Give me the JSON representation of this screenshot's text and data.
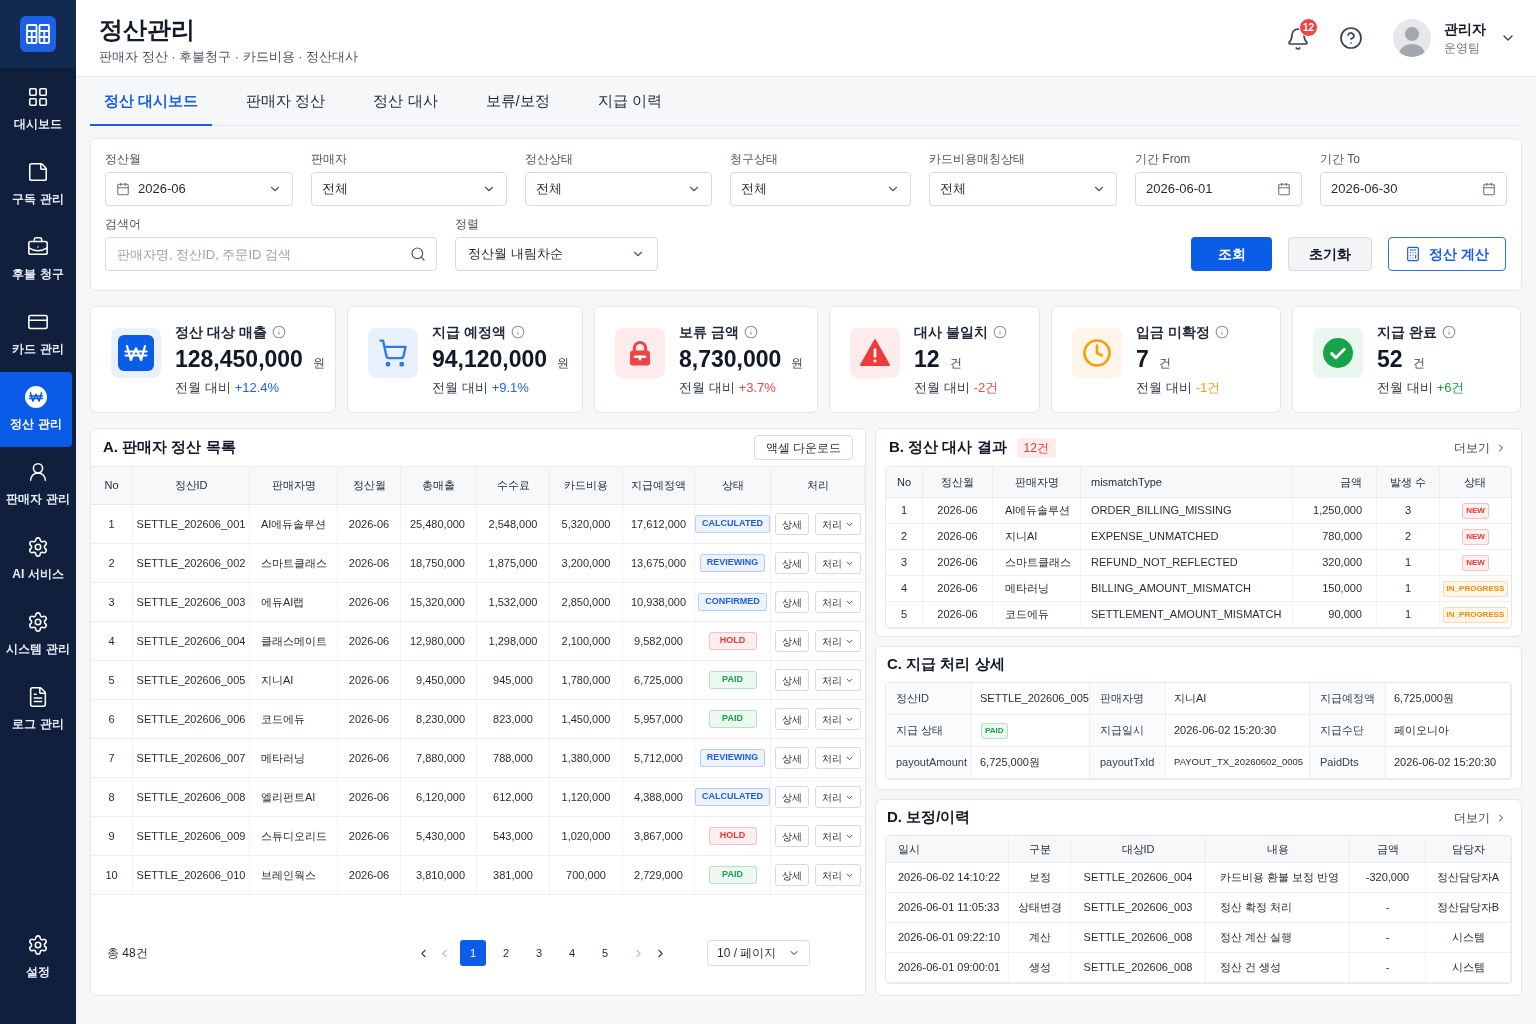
{
  "sidebar": {
    "items": [
      {
        "label": "대시보드",
        "selected": false
      },
      {
        "label": "구독 관리",
        "selected": false
      },
      {
        "label": "후불 청구",
        "selected": false
      },
      {
        "label": "카드 관리",
        "selected": false
      },
      {
        "label": "정산 관리",
        "selected": true
      },
      {
        "label": "판매자 관리",
        "selected": false
      },
      {
        "label": "AI 서비스",
        "selected": false
      },
      {
        "label": "시스템 관리",
        "selected": false
      },
      {
        "label": "로그 관리",
        "selected": false
      }
    ],
    "bottom_items": [
      {
        "label": "설정",
        "selected": false
      }
    ]
  },
  "header": {
    "title": "정산관리",
    "subtitle": "판매자 정산 · 후불청구 · 카드비용 · 정산대사",
    "notification_count": "12",
    "user": {
      "name": "관리자",
      "team": "운영팀"
    }
  },
  "tabs": [
    {
      "label": "정산 대시보드",
      "selected": true
    },
    {
      "label": "판매자 정산",
      "selected": false
    },
    {
      "label": "정산 대사",
      "selected": false
    },
    {
      "label": "보류/보정",
      "selected": false
    },
    {
      "label": "지급 이력",
      "selected": false
    }
  ],
  "filters": {
    "fields": [
      {
        "label": "정산월",
        "value": "2026-06",
        "kind": "month"
      },
      {
        "label": "판매자",
        "value": "전체",
        "kind": "select"
      },
      {
        "label": "정산상태",
        "value": "전체",
        "kind": "select"
      },
      {
        "label": "청구상태",
        "value": "전체",
        "kind": "select"
      },
      {
        "label": "카드비용매칭상태",
        "value": "전체",
        "kind": "select"
      },
      {
        "label": "기간 From",
        "value": "2026-06-01",
        "kind": "date"
      },
      {
        "label": "기간 To",
        "value": "2026-06-30",
        "kind": "date"
      }
    ],
    "search": {
      "label": "검색어",
      "placeholder": "판매자명, 정산ID, 주문ID 검색"
    },
    "sort": {
      "label": "정렬",
      "value": "정산월 내림차순"
    },
    "buttons": [
      {
        "label": "조회",
        "kind": "primary"
      },
      {
        "label": "초기화",
        "kind": "secondary"
      },
      {
        "label": "정산 계산",
        "kind": "outline"
      }
    ]
  },
  "kpis": [
    {
      "title": "정산 대상 매출",
      "value": "128,450,000",
      "unit": "원",
      "change_label": "전월 대비",
      "change": "+12.4%",
      "color": "#1f63e6"
    },
    {
      "title": "지급 예정액",
      "value": "94,120,000",
      "unit": "원",
      "change_label": "전월 대비",
      "change": "+9.1%",
      "color": "#1f63e6"
    },
    {
      "title": "보류 금액",
      "value": "8,730,000",
      "unit": "원",
      "change_label": "전월 대비",
      "change": "+3.7%",
      "color": "#ef4444"
    },
    {
      "title": "대사 불일치",
      "value": "12",
      "unit": "건",
      "change_label": "전월 대비",
      "change": "-2건",
      "color": "#ef4444"
    },
    {
      "title": "입금 미확정",
      "value": "7",
      "unit": "건",
      "change_label": "전월 대비",
      "change": "-1건",
      "color": "#f59e0b"
    },
    {
      "title": "지급 완료",
      "value": "52",
      "unit": "건",
      "change_label": "전월 대비",
      "change": "+6건",
      "color": "#16a34a"
    }
  ],
  "settlement_list": {
    "title": "A. 판매자 정산 목록",
    "download_button": "액셀 다운로드",
    "columns": [
      "No",
      "정산ID",
      "판매자명",
      "정산월",
      "총매출",
      "수수료",
      "카드비용",
      "지급예정액",
      "상태",
      "처리"
    ],
    "rows": [
      {
        "cells": [
          "1",
          "SETTLE_202606_001",
          "AI에듀솔루션",
          "2026-06",
          "25,480,000",
          "2,548,000",
          "5,320,000",
          "17,612,000"
        ],
        "status": {
          "label": "CALCULATED",
          "color": "#1d5fe0"
        },
        "actions": [
          {
            "label": "상세",
            "kind": "button"
          },
          {
            "label": "처리",
            "kind": "menu"
          }
        ]
      },
      {
        "cells": [
          "2",
          "SETTLE_202606_002",
          "스마트클래스",
          "2026-06",
          "18,750,000",
          "1,875,000",
          "3,200,000",
          "13,675,000"
        ],
        "status": {
          "label": "REVIEWING",
          "color": "#1d5fe0"
        },
        "actions": [
          {
            "label": "상세",
            "kind": "button"
          },
          {
            "label": "처리",
            "kind": "menu"
          }
        ]
      },
      {
        "cells": [
          "3",
          "SETTLE_202606_003",
          "에듀AI랩",
          "2026-06",
          "15,320,000",
          "1,532,000",
          "2,850,000",
          "10,938,000"
        ],
        "status": {
          "label": "CONFIRMED",
          "color": "#1d5fe0"
        },
        "actions": [
          {
            "label": "상세",
            "kind": "button"
          },
          {
            "label": "처리",
            "kind": "menu"
          }
        ]
      },
      {
        "cells": [
          "4",
          "SETTLE_202606_004",
          "클래스메이트",
          "2026-06",
          "12,980,000",
          "1,298,000",
          "2,100,000",
          "9,582,000"
        ],
        "status": {
          "label": "HOLD",
          "color": "#e53935"
        },
        "actions": [
          {
            "label": "상세",
            "kind": "button"
          },
          {
            "label": "처리",
            "kind": "menu"
          }
        ]
      },
      {
        "cells": [
          "5",
          "SETTLE_202606_005",
          "지니AI",
          "2026-06",
          "9,450,000",
          "945,000",
          "1,780,000",
          "6,725,000"
        ],
        "status": {
          "label": "PAID",
          "color": "#16a34a"
        },
        "actions": [
          {
            "label": "상세",
            "kind": "button"
          },
          {
            "label": "처리",
            "kind": "menu"
          }
        ]
      },
      {
        "cells": [
          "6",
          "SETTLE_202606_006",
          "코드에듀",
          "2026-06",
          "8,230,000",
          "823,000",
          "1,450,000",
          "5,957,000"
        ],
        "status": {
          "label": "PAID",
          "color": "#16a34a"
        },
        "actions": [
          {
            "label": "상세",
            "kind": "button"
          },
          {
            "label": "처리",
            "kind": "menu"
          }
        ]
      },
      {
        "cells": [
          "7",
          "SETTLE_202606_007",
          "메타러닝",
          "2026-06",
          "7,880,000",
          "788,000",
          "1,380,000",
          "5,712,000"
        ],
        "status": {
          "label": "REVIEWING",
          "color": "#1d5fe0"
        },
        "actions": [
          {
            "label": "상세",
            "kind": "button"
          },
          {
            "label": "처리",
            "kind": "menu"
          }
        ]
      },
      {
        "cells": [
          "8",
          "SETTLE_202606_008",
          "엘리펀트AI",
          "2026-06",
          "6,120,000",
          "612,000",
          "1,120,000",
          "4,388,000"
        ],
        "status": {
          "label": "CALCULATED",
          "color": "#1d5fe0"
        },
        "actions": [
          {
            "label": "상세",
            "kind": "button"
          },
          {
            "label": "처리",
            "kind": "menu"
          }
        ]
      },
      {
        "cells": [
          "9",
          "SETTLE_202606_009",
          "스튜디오리드",
          "2026-06",
          "5,430,000",
          "543,000",
          "1,020,000",
          "3,867,000"
        ],
        "status": {
          "label": "HOLD",
          "color": "#e53935"
        },
        "actions": [
          {
            "label": "상세",
            "kind": "button"
          },
          {
            "label": "처리",
            "kind": "menu"
          }
        ]
      },
      {
        "cells": [
          "10",
          "SETTLE_202606_010",
          "브레인웍스",
          "2026-06",
          "3,810,000",
          "381,000",
          "700,000",
          "2,729,000"
        ],
        "status": {
          "label": "PAID",
          "color": "#16a34a"
        },
        "actions": [
          {
            "label": "상세",
            "kind": "button"
          },
          {
            "label": "처리",
            "kind": "menu"
          }
        ]
      }
    ],
    "pagination": {
      "total": "총 48건",
      "nav_start": [
        {
          "disabled": false
        },
        {
          "disabled": true
        }
      ],
      "pages": [
        {
          "label": "1",
          "selected": true
        },
        {
          "label": "2",
          "selected": false
        },
        {
          "label": "3",
          "selected": false
        },
        {
          "label": "4",
          "selected": false
        },
        {
          "label": "5",
          "selected": false
        }
      ],
      "nav_end": [
        {
          "disabled": true
        },
        {
          "disabled": false
        }
      ],
      "page_size": "10 / 페이지"
    }
  },
  "reconciliation": {
    "title": "B. 정산 대사 결과",
    "count": "12건",
    "more_link": "더보기",
    "columns": [
      "No",
      "정산월",
      "판매자명",
      "mismatchType",
      "금액",
      "발생 수",
      "상태"
    ],
    "rows": [
      {
        "cells": [
          "1",
          "2026-06",
          "AI에듀솔루션",
          "ORDER_BILLING_MISSING",
          "1,250,000",
          "3"
        ],
        "status": {
          "label": "NEW",
          "color": "#e53935"
        }
      },
      {
        "cells": [
          "2",
          "2026-06",
          "지니AI",
          "EXPENSE_UNMATCHED",
          "780,000",
          "2"
        ],
        "status": {
          "label": "NEW",
          "color": "#e53935"
        }
      },
      {
        "cells": [
          "3",
          "2026-06",
          "스마트클래스",
          "REFUND_NOT_REFLECTED",
          "320,000",
          "1"
        ],
        "status": {
          "label": "NEW",
          "color": "#e53935"
        }
      },
      {
        "cells": [
          "4",
          "2026-06",
          "메타러닝",
          "BILLING_AMOUNT_MISMATCH",
          "150,000",
          "1"
        ],
        "status": {
          "label": "IN_PROGRESS",
          "color": "#f08c00"
        }
      },
      {
        "cells": [
          "5",
          "2026-06",
          "코드에듀",
          "SETTLEMENT_AMOUNT_MISMATCH",
          "90,000",
          "1"
        ],
        "status": {
          "label": "IN_PROGRESS",
          "color": "#f08c00"
        }
      }
    ]
  },
  "payout_detail": {
    "title": "C. 지급 처리 상세",
    "rows": [
      {
        "cells": [
          {
            "label": "정산ID",
            "value": "SETTLE_202606_005",
            "kind": "text"
          },
          {
            "label": "판매자명",
            "value": "지니AI",
            "kind": "text"
          },
          {
            "label": "지급예정액",
            "value": "6,725,000원",
            "kind": "text"
          }
        ]
      },
      {
        "cells": [
          {
            "label": "지급 상태",
            "value": "PAID",
            "kind": "badge",
            "color": "#16a34a"
          },
          {
            "label": "지급일시",
            "value": "2026-06-02 15:20:30",
            "kind": "text"
          },
          {
            "label": "지급수단",
            "value": "페이오니아",
            "kind": "text"
          }
        ]
      },
      {
        "cells": [
          {
            "label": "payoutAmount",
            "value": "6,725,000원",
            "kind": "text"
          },
          {
            "label": "payoutTxId",
            "value": "PAYOUT_TX_20260602_0005",
            "kind": "small"
          },
          {
            "label": "PaidDts",
            "value": "2026-06-02 15:20:30",
            "kind": "text"
          }
        ]
      }
    ]
  },
  "history": {
    "title": "D. 보정/이력",
    "more_link": "더보기",
    "columns": [
      "일시",
      "구분",
      "대상ID",
      "내용",
      "금액",
      "담당자"
    ],
    "rows": [
      {
        "cells": [
          "2026-06-02 14:10:22",
          "보정",
          "SETTLE_202606_004",
          "카드비용 환불 보정 반영",
          "-320,000",
          "정산담당자A"
        ]
      },
      {
        "cells": [
          "2026-06-01 11:05:33",
          "상태변경",
          "SETTLE_202606_003",
          "정산 확정 처리",
          "-",
          "정산담당자B"
        ]
      },
      {
        "cells": [
          "2026-06-01 09:22:10",
          "계산",
          "SETTLE_202606_008",
          "정산 계산 실행",
          "-",
          "시스템"
        ]
      },
      {
        "cells": [
          "2026-06-01 09:00:01",
          "생성",
          "SETTLE_202606_008",
          "정산 건 생성",
          "-",
          "시스템"
        ]
      }
    ]
  }
}
